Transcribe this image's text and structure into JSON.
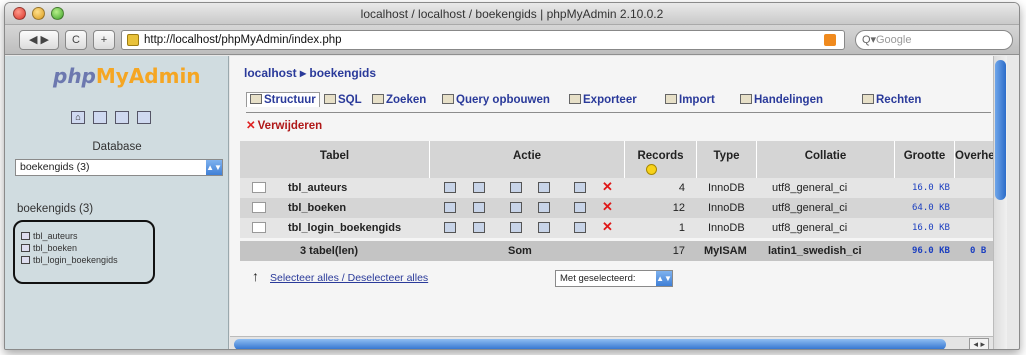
{
  "window": {
    "title": "localhost / localhost / boekengids | phpMyAdmin 2.10.0.2"
  },
  "toolbar": {
    "back_label": "◀ ▶",
    "reload_label": "C",
    "add_label": "+",
    "url": "http://localhost/phpMyAdmin/index.php",
    "search_placeholder": "Google"
  },
  "sidebar": {
    "logo_php": "php",
    "logo_myadmin": "MyAdmin",
    "database_label": "Database",
    "database_selected": "boekengids (3)",
    "db_title": "boekengids (3)",
    "tables": [
      "tbl_auteurs",
      "tbl_boeken",
      "tbl_login_boekengids"
    ]
  },
  "main": {
    "breadcrumb": "localhost ▸ boekengids",
    "tabs": [
      {
        "label": "Structuur",
        "active": true
      },
      {
        "label": "SQL"
      },
      {
        "label": "Zoeken"
      },
      {
        "label": "Query opbouwen"
      },
      {
        "label": "Exporteer"
      },
      {
        "label": "Import"
      },
      {
        "label": "Handelingen"
      },
      {
        "label": "Rechten"
      }
    ],
    "drop_label": "Verwijderen",
    "headers": {
      "tabel": "Tabel",
      "actie": "Actie",
      "records": "Records",
      "type": "Type",
      "collatie": "Collatie",
      "grootte": "Grootte",
      "overhead": "Overhe"
    },
    "rows": [
      {
        "name": "tbl_auteurs",
        "records": "4",
        "type": "InnoDB",
        "collation": "utf8_general_ci",
        "size": "16.0 KB"
      },
      {
        "name": "tbl_boeken",
        "records": "12",
        "type": "InnoDB",
        "collation": "utf8_general_ci",
        "size": "64.0 KB"
      },
      {
        "name": "tbl_login_boekengids",
        "records": "1",
        "type": "InnoDB",
        "collation": "utf8_general_ci",
        "size": "16.0 KB"
      }
    ],
    "footer": {
      "tables": "3 tabel(len)",
      "sum": "Som",
      "records": "17",
      "type": "MyISAM",
      "collation": "latin1_swedish_ci",
      "size": "96.0 KB",
      "overhead": "0 B"
    },
    "select_links": "Selecteer alles / Deselecteer alles",
    "mass_action": "Met geselecteerd:",
    "scroll_btns": "◂ ▸"
  },
  "colors": {
    "link": "#2a3a9a",
    "drop": "#b01818",
    "sidebar_bg": "#d0dce0",
    "scroll_accent": "#2f70cd"
  }
}
